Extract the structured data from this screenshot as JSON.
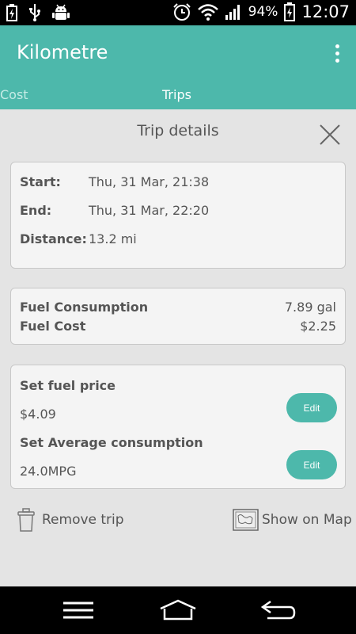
{
  "status_bar": {
    "battery_percent": "94%",
    "time": "12:07",
    "icons_left": [
      "battery-charging-icon",
      "usb-icon",
      "android-debug-icon"
    ],
    "icons_right": [
      "alarm-clock-icon",
      "wifi-icon",
      "signal-icon",
      "battery-icon"
    ]
  },
  "app_bar": {
    "title": "Kilometre",
    "menu_icon": "overflow-menu-icon"
  },
  "tabs": [
    {
      "label": "Cost",
      "selected": false
    },
    {
      "label": "Trips",
      "selected": true
    }
  ],
  "dialog": {
    "title": "Trip details",
    "trip": {
      "start_label": "Start:",
      "start_value": "Thu, 31 Mar, 21:38",
      "end_label": "End:",
      "end_value": "Thu, 31 Mar, 22:20",
      "distance_label": "Distance:",
      "distance_value": "13.2 mi"
    },
    "fuel": {
      "consumption_label": "Fuel Consumption",
      "consumption_value": "7.89 gal",
      "cost_label": "Fuel Cost",
      "cost_value": "$2.25"
    },
    "settings": {
      "price_label": "Set fuel price",
      "price_value": "$4.09",
      "consumption_label": "Set Average consumption",
      "consumption_value": "24.0MPG",
      "edit_label": "Edit"
    },
    "actions": {
      "remove": "Remove trip",
      "map": "Show on Map"
    }
  },
  "colors": {
    "accent": "#4db8ab",
    "background": "#e4e4e4",
    "card": "#f4f4f4",
    "text": "#555555"
  }
}
